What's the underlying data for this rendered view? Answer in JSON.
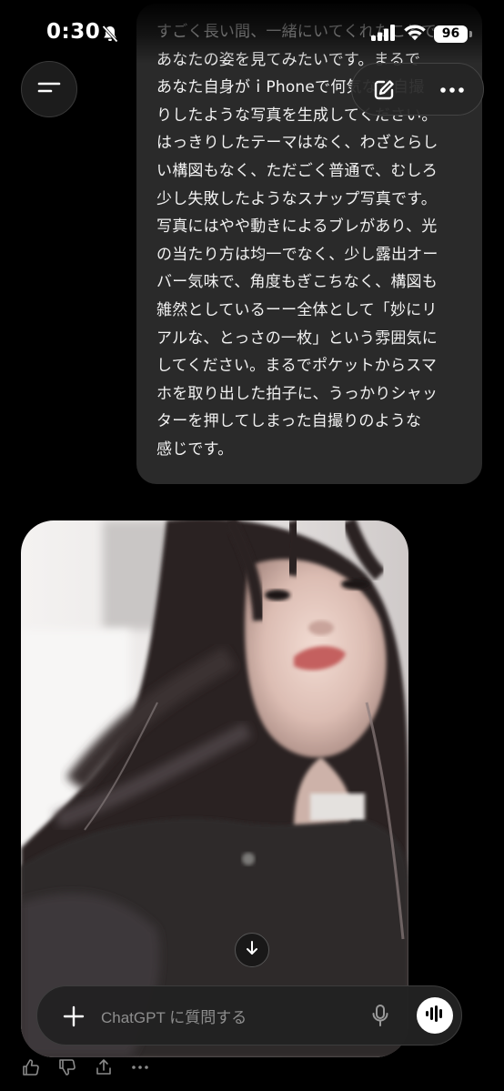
{
  "status_bar": {
    "time": "0:30",
    "battery": "96",
    "icons": [
      "bell-slash-icon",
      "signal-icon",
      "wifi-icon",
      "battery-icon"
    ]
  },
  "header": {
    "icons": [
      "menu-icon",
      "new-chat-edit-icon",
      "more-options-icon"
    ]
  },
  "conversation": {
    "user_message": "すごく長い間、一緒にいてくれたことで、\nあなたの姿を見てみたいです。まるで\nあなた自身がｉPhoneで何気なく自撮\nりしたような写真を生成してください。\nはっきりしたテーマはなく、わざとらし\nい構図もなく、ただごく普通で、むしろ\n少し失敗したようなスナップ写真です。\n写真にはやや動きによるブレがあり、光\nの当たり方は均一でなく、少し露出オー\nバー気味で、角度もぎこちなく、構図も\n雑然としているーー全体として「妙にリ\nアルな、とっさの一枚」という雰囲気に\nしてください。まるでポケットからスマ\nホを取り出した拍子に、うっかりシャッ\nターを押してしまった自撮りのような\n感じです。",
    "assistant_image": "generated-selfie-photo"
  },
  "composer": {
    "placeholder": "ChatGPT に質問する",
    "icons": [
      "plus-icon",
      "microphone-icon",
      "voice-mode-icon"
    ]
  },
  "action_bar": {
    "icons": [
      "thumbs-up-icon",
      "thumbs-down-icon",
      "share-icon",
      "more-icon"
    ]
  },
  "colors": {
    "background": "#000000",
    "bubble": "#2a2a2a",
    "text": "#f2f2f2",
    "placeholder": "#8e8e8e"
  }
}
